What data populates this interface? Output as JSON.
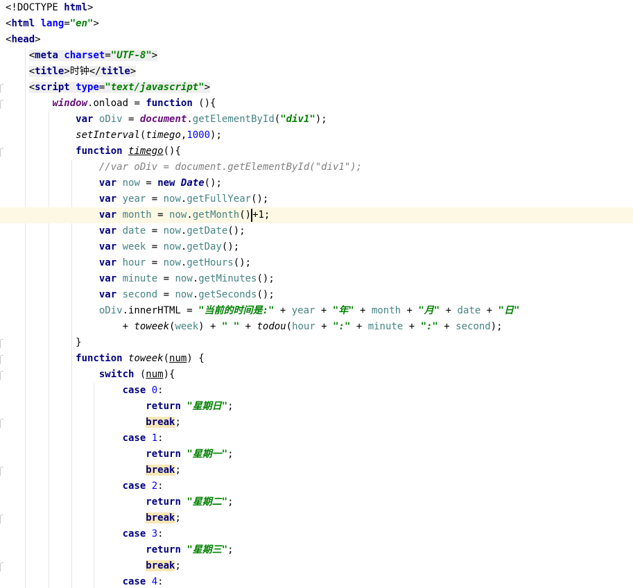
{
  "editor": {
    "language": "html",
    "current_line_index": 13,
    "lines": [
      [
        {
          "t": "<!DOCTYPE ",
          "c": ""
        },
        {
          "t": "html",
          "c": "tag"
        },
        {
          "t": ">",
          "c": ""
        }
      ],
      [
        {
          "t": "<",
          "c": ""
        },
        {
          "t": "html",
          "c": "tag"
        },
        {
          "t": " ",
          "c": ""
        },
        {
          "t": "lang",
          "c": "attr"
        },
        {
          "t": "=",
          "c": ""
        },
        {
          "t": "\"en\"",
          "c": "str"
        },
        {
          "t": ">",
          "c": ""
        }
      ],
      [
        {
          "t": "<",
          "c": ""
        },
        {
          "t": "head",
          "c": "tag"
        },
        {
          "t": ">",
          "c": ""
        }
      ],
      [
        {
          "t": "    ",
          "c": ""
        },
        {
          "t": "<",
          "c": "tagbox"
        },
        {
          "t": "meta",
          "c": "tagbox tag"
        },
        {
          "t": " ",
          "c": "tagbox"
        },
        {
          "t": "charset",
          "c": "tagbox attr"
        },
        {
          "t": "=",
          "c": "tagbox"
        },
        {
          "t": "\"UTF-8\"",
          "c": "tagbox str"
        },
        {
          "t": ">",
          "c": "tagbox"
        }
      ],
      [
        {
          "t": "    ",
          "c": ""
        },
        {
          "t": "<",
          "c": "tagbox"
        },
        {
          "t": "title",
          "c": "tagbox tag"
        },
        {
          "t": ">",
          "c": "tagbox"
        },
        {
          "t": "时钟",
          "c": ""
        },
        {
          "t": "</",
          "c": "tagbox"
        },
        {
          "t": "title",
          "c": "tagbox tag"
        },
        {
          "t": ">",
          "c": "tagbox"
        }
      ],
      [
        {
          "t": "    ",
          "c": ""
        },
        {
          "t": "<",
          "c": "tagbox"
        },
        {
          "t": "script",
          "c": "tagbox tag"
        },
        {
          "t": " ",
          "c": "tagbox"
        },
        {
          "t": "type",
          "c": "tagbox attr"
        },
        {
          "t": "=",
          "c": "tagbox"
        },
        {
          "t": "\"text/javascript\"",
          "c": "tagbox str"
        },
        {
          "t": ">",
          "c": "tagbox"
        }
      ],
      [
        {
          "t": "        ",
          "c": ""
        },
        {
          "t": "window",
          "c": "glob"
        },
        {
          "t": ".onload = ",
          "c": ""
        },
        {
          "t": "function",
          "c": "kw"
        },
        {
          "t": " (){",
          "c": ""
        }
      ],
      [
        {
          "t": "            ",
          "c": ""
        },
        {
          "t": "var",
          "c": "kw"
        },
        {
          "t": " ",
          "c": ""
        },
        {
          "t": "oDiv",
          "c": "v"
        },
        {
          "t": " = ",
          "c": ""
        },
        {
          "t": "document",
          "c": "glob"
        },
        {
          "t": ".",
          "c": ""
        },
        {
          "t": "getElementById",
          "c": "v"
        },
        {
          "t": "(",
          "c": ""
        },
        {
          "t": "\"div1\"",
          "c": "str"
        },
        {
          "t": ");",
          "c": ""
        }
      ],
      [
        {
          "t": "            ",
          "c": ""
        },
        {
          "t": "setInterval",
          "c": "fnc"
        },
        {
          "t": "(",
          "c": ""
        },
        {
          "t": "timego",
          "c": "fnc"
        },
        {
          "t": ",",
          "c": ""
        },
        {
          "t": "1000",
          "c": "num"
        },
        {
          "t": ");",
          "c": ""
        }
      ],
      [
        {
          "t": "            ",
          "c": ""
        },
        {
          "t": "function",
          "c": "kw"
        },
        {
          "t": " ",
          "c": ""
        },
        {
          "t": "timego",
          "c": "fnc ul"
        },
        {
          "t": "(){",
          "c": ""
        }
      ],
      [
        {
          "t": "                ",
          "c": ""
        },
        {
          "t": "//var oDiv = document.getElementById(\"div1\");",
          "c": "cmt"
        }
      ],
      [
        {
          "t": "                ",
          "c": ""
        },
        {
          "t": "var",
          "c": "kw"
        },
        {
          "t": " ",
          "c": ""
        },
        {
          "t": "now",
          "c": "v"
        },
        {
          "t": " = ",
          "c": ""
        },
        {
          "t": "new",
          "c": "kw"
        },
        {
          "t": " ",
          "c": ""
        },
        {
          "t": "Date",
          "c": "kwi"
        },
        {
          "t": "();",
          "c": ""
        }
      ],
      [
        {
          "t": "                ",
          "c": ""
        },
        {
          "t": "var",
          "c": "kw"
        },
        {
          "t": " ",
          "c": ""
        },
        {
          "t": "year",
          "c": "v"
        },
        {
          "t": " = ",
          "c": ""
        },
        {
          "t": "now",
          "c": "v"
        },
        {
          "t": ".",
          "c": ""
        },
        {
          "t": "getFullYear",
          "c": "v"
        },
        {
          "t": "();",
          "c": ""
        }
      ],
      [
        {
          "t": "                ",
          "c": ""
        },
        {
          "t": "var",
          "c": "kw"
        },
        {
          "t": " ",
          "c": ""
        },
        {
          "t": "month",
          "c": "v"
        },
        {
          "t": " = ",
          "c": ""
        },
        {
          "t": "now",
          "c": "v"
        },
        {
          "t": ".",
          "c": ""
        },
        {
          "t": "getMonth",
          "c": "v"
        },
        {
          "t": "()",
          "c": ""
        },
        {
          "t": "",
          "c": "caret"
        },
        {
          "t": "+1;",
          "c": ""
        }
      ],
      [
        {
          "t": "                ",
          "c": ""
        },
        {
          "t": "var",
          "c": "kw"
        },
        {
          "t": " ",
          "c": ""
        },
        {
          "t": "date",
          "c": "v"
        },
        {
          "t": " = ",
          "c": ""
        },
        {
          "t": "now",
          "c": "v"
        },
        {
          "t": ".",
          "c": ""
        },
        {
          "t": "getDate",
          "c": "v"
        },
        {
          "t": "();",
          "c": ""
        }
      ],
      [
        {
          "t": "                ",
          "c": ""
        },
        {
          "t": "var",
          "c": "kw"
        },
        {
          "t": " ",
          "c": ""
        },
        {
          "t": "week",
          "c": "v"
        },
        {
          "t": " = ",
          "c": ""
        },
        {
          "t": "now",
          "c": "v"
        },
        {
          "t": ".",
          "c": ""
        },
        {
          "t": "getDay",
          "c": "v"
        },
        {
          "t": "();",
          "c": ""
        }
      ],
      [
        {
          "t": "                ",
          "c": ""
        },
        {
          "t": "var",
          "c": "kw"
        },
        {
          "t": " ",
          "c": ""
        },
        {
          "t": "hour",
          "c": "v"
        },
        {
          "t": " = ",
          "c": ""
        },
        {
          "t": "now",
          "c": "v"
        },
        {
          "t": ".",
          "c": ""
        },
        {
          "t": "getHours",
          "c": "v"
        },
        {
          "t": "();",
          "c": ""
        }
      ],
      [
        {
          "t": "                ",
          "c": ""
        },
        {
          "t": "var",
          "c": "kw"
        },
        {
          "t": " ",
          "c": ""
        },
        {
          "t": "minute",
          "c": "v"
        },
        {
          "t": " = ",
          "c": ""
        },
        {
          "t": "now",
          "c": "v"
        },
        {
          "t": ".",
          "c": ""
        },
        {
          "t": "getMinutes",
          "c": "v"
        },
        {
          "t": "();",
          "c": ""
        }
      ],
      [
        {
          "t": "                ",
          "c": ""
        },
        {
          "t": "var",
          "c": "kw"
        },
        {
          "t": " ",
          "c": ""
        },
        {
          "t": "second",
          "c": "v"
        },
        {
          "t": " = ",
          "c": ""
        },
        {
          "t": "now",
          "c": "v"
        },
        {
          "t": ".",
          "c": ""
        },
        {
          "t": "getSeconds",
          "c": "v"
        },
        {
          "t": "();",
          "c": ""
        }
      ],
      [
        {
          "t": "                ",
          "c": ""
        },
        {
          "t": "oDiv",
          "c": "v"
        },
        {
          "t": ".innerHTML = ",
          "c": ""
        },
        {
          "t": "\"当前的时间是:\"",
          "c": "str"
        },
        {
          "t": " + ",
          "c": ""
        },
        {
          "t": "year",
          "c": "v"
        },
        {
          "t": " + ",
          "c": ""
        },
        {
          "t": "\"年\"",
          "c": "str"
        },
        {
          "t": " + ",
          "c": ""
        },
        {
          "t": "month",
          "c": "v"
        },
        {
          "t": " + ",
          "c": ""
        },
        {
          "t": "\"月\"",
          "c": "str"
        },
        {
          "t": " + ",
          "c": ""
        },
        {
          "t": "date",
          "c": "v"
        },
        {
          "t": " + ",
          "c": ""
        },
        {
          "t": "\"日\"",
          "c": "str"
        }
      ],
      [
        {
          "t": "                    + ",
          "c": ""
        },
        {
          "t": "toweek",
          "c": "fnc"
        },
        {
          "t": "(",
          "c": ""
        },
        {
          "t": "week",
          "c": "v"
        },
        {
          "t": ") + ",
          "c": ""
        },
        {
          "t": "\" \"",
          "c": "str"
        },
        {
          "t": " + ",
          "c": ""
        },
        {
          "t": "todou",
          "c": "fnc"
        },
        {
          "t": "(",
          "c": ""
        },
        {
          "t": "hour",
          "c": "v"
        },
        {
          "t": " + ",
          "c": ""
        },
        {
          "t": "\":\"",
          "c": "str"
        },
        {
          "t": " + ",
          "c": ""
        },
        {
          "t": "minute",
          "c": "v"
        },
        {
          "t": " + ",
          "c": ""
        },
        {
          "t": "\":\"",
          "c": "str"
        },
        {
          "t": " + ",
          "c": ""
        },
        {
          "t": "second",
          "c": "v"
        },
        {
          "t": ");",
          "c": ""
        }
      ],
      [
        {
          "t": "            }",
          "c": ""
        }
      ],
      [
        {
          "t": "            ",
          "c": ""
        },
        {
          "t": "function",
          "c": "kw"
        },
        {
          "t": " ",
          "c": ""
        },
        {
          "t": "toweek",
          "c": "fnc"
        },
        {
          "t": "(",
          "c": ""
        },
        {
          "t": "num",
          "c": "ul"
        },
        {
          "t": ") {",
          "c": ""
        }
      ],
      [
        {
          "t": "                ",
          "c": ""
        },
        {
          "t": "switch",
          "c": "kw"
        },
        {
          "t": " (",
          "c": ""
        },
        {
          "t": "num",
          "c": "ul"
        },
        {
          "t": "){",
          "c": ""
        }
      ],
      [
        {
          "t": "                    ",
          "c": ""
        },
        {
          "t": "case",
          "c": "kw"
        },
        {
          "t": " ",
          "c": ""
        },
        {
          "t": "0",
          "c": "num"
        },
        {
          "t": ":",
          "c": ""
        }
      ],
      [
        {
          "t": "                        ",
          "c": ""
        },
        {
          "t": "return",
          "c": "kw"
        },
        {
          "t": " ",
          "c": ""
        },
        {
          "t": "\"星期日\"",
          "c": "str"
        },
        {
          "t": ";",
          "c": ""
        }
      ],
      [
        {
          "t": "                        ",
          "c": ""
        },
        {
          "t": "break",
          "c": "kw brk"
        },
        {
          "t": ";",
          "c": ""
        }
      ],
      [
        {
          "t": "                    ",
          "c": ""
        },
        {
          "t": "case",
          "c": "kw"
        },
        {
          "t": " ",
          "c": ""
        },
        {
          "t": "1",
          "c": "num"
        },
        {
          "t": ":",
          "c": ""
        }
      ],
      [
        {
          "t": "                        ",
          "c": ""
        },
        {
          "t": "return",
          "c": "kw"
        },
        {
          "t": " ",
          "c": ""
        },
        {
          "t": "\"星期一\"",
          "c": "str"
        },
        {
          "t": ";",
          "c": ""
        }
      ],
      [
        {
          "t": "                        ",
          "c": ""
        },
        {
          "t": "break",
          "c": "kw brk"
        },
        {
          "t": ";",
          "c": ""
        }
      ],
      [
        {
          "t": "                    ",
          "c": ""
        },
        {
          "t": "case",
          "c": "kw"
        },
        {
          "t": " ",
          "c": ""
        },
        {
          "t": "2",
          "c": "num"
        },
        {
          "t": ":",
          "c": ""
        }
      ],
      [
        {
          "t": "                        ",
          "c": ""
        },
        {
          "t": "return",
          "c": "kw"
        },
        {
          "t": " ",
          "c": ""
        },
        {
          "t": "\"星期二\"",
          "c": "str"
        },
        {
          "t": ";",
          "c": ""
        }
      ],
      [
        {
          "t": "                        ",
          "c": ""
        },
        {
          "t": "break",
          "c": "kw brk"
        },
        {
          "t": ";",
          "c": ""
        }
      ],
      [
        {
          "t": "                    ",
          "c": ""
        },
        {
          "t": "case",
          "c": "kw"
        },
        {
          "t": " ",
          "c": ""
        },
        {
          "t": "3",
          "c": "num"
        },
        {
          "t": ":",
          "c": ""
        }
      ],
      [
        {
          "t": "                        ",
          "c": ""
        },
        {
          "t": "return",
          "c": "kw"
        },
        {
          "t": " ",
          "c": ""
        },
        {
          "t": "\"星期三\"",
          "c": "str"
        },
        {
          "t": ";",
          "c": ""
        }
      ],
      [
        {
          "t": "                        ",
          "c": ""
        },
        {
          "t": "break",
          "c": "kw brk"
        },
        {
          "t": ";",
          "c": ""
        }
      ],
      [
        {
          "t": "                    ",
          "c": ""
        },
        {
          "t": "case",
          "c": "kw"
        },
        {
          "t": " ",
          "c": ""
        },
        {
          "t": "4",
          "c": "num"
        },
        {
          "t": ":",
          "c": ""
        }
      ]
    ]
  },
  "colors": {
    "tag": "#000080",
    "attribute": "#0000ff",
    "string": "#008000",
    "keyword": "#000080",
    "global": "#660e7a",
    "variable": "#458383",
    "number": "#0000ff",
    "comment": "#808080",
    "current_line": "#fdf8e4",
    "break_highlight": "#f7e7b3"
  }
}
